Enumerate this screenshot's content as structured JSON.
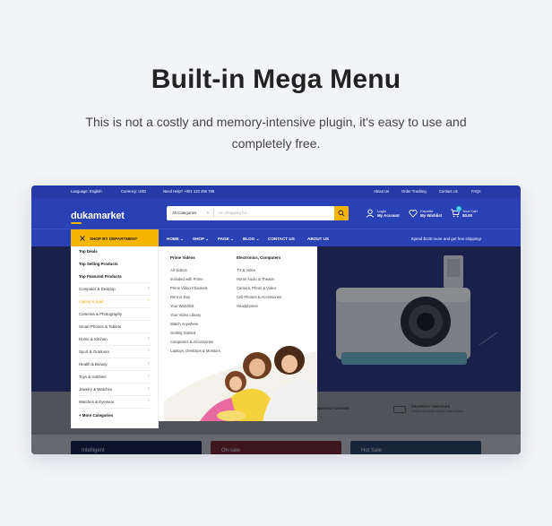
{
  "hero": {
    "title": "Built-in Mega Menu",
    "subtitle": "This is not a costly and memory-intensive plugin, it's easy to use and completely free."
  },
  "topbar": {
    "language": "Language: English",
    "currency": "Currency: USD",
    "help": "Need Help? +001 123 456 789",
    "links": [
      "About Us",
      "Order Tracking",
      "Contact Us",
      "FAQs"
    ]
  },
  "header": {
    "logo": "dukamarket",
    "search_category": "All Categories",
    "search_placeholder": "I'm shopping for...",
    "login_top": "Login",
    "login_bottom": "My Account",
    "wish_top": "Favorite",
    "wish_bottom": "My Wishlist",
    "cart_top": "Your Cart",
    "cart_bottom": "$0.00",
    "cart_count": "0"
  },
  "navbar": {
    "dept_label": "SHOP BY DEPARTMENT",
    "items": [
      "HOME",
      "SHOP",
      "PAGE",
      "BLOG",
      "CONTACT US",
      "ABOUT US"
    ],
    "promo": "Spend $120 more and get free shipping!"
  },
  "departments": {
    "top": [
      "Top Deals",
      "Top Selling Products",
      "Top Featured Products"
    ],
    "items": [
      "Computer & Desktop",
      "Laptop & Ipad",
      "Cameras & Photography",
      "Smart Phones & Tablets",
      "Home & Kitchen",
      "Sport & Outdoors",
      "Health & Beauty",
      "Toys & Hobbies",
      "Jewelry & Watches",
      "Watches & Eyewear"
    ],
    "more": "+ More Categories"
  },
  "mega": {
    "col1_title": "Prime Videos",
    "col1_links": [
      "All Videos",
      "Included with Prime",
      "Prime Video Channels",
      "Rent or Buy",
      "Your Watchlist",
      "Your Video Library",
      "Watch Anywhere",
      "Getting Started",
      "Computers & Accessories",
      "Laptops, Desktops & Monitors"
    ],
    "col2_title": "Electronics, Computers",
    "col2_links": [
      "TV & Video",
      "Home Audio & Theater",
      "Camera, Photo & Video",
      "Cell Phones & Accessories",
      "Headphones"
    ]
  },
  "features": {
    "f1": "MONTHLY CENTER",
    "f2_title": "PROPERTY SERVICES",
    "f2_sub": "Ut enim ad minim veniam quis nostrud"
  },
  "cards": [
    "Intelligent",
    "On-sale",
    "Hot Sale"
  ],
  "colors": {
    "brand_blue": "#2a40b5",
    "accent_yellow": "#f7b500"
  }
}
